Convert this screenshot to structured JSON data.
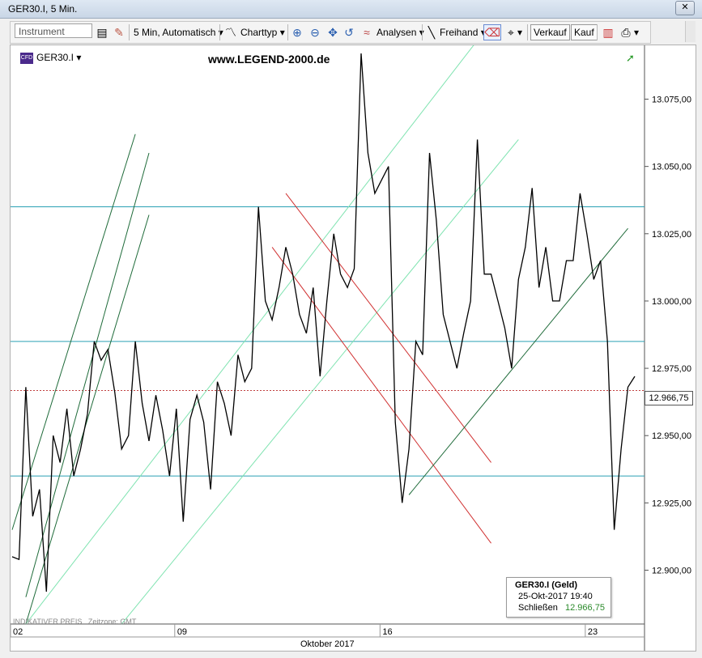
{
  "window": {
    "title": "GER30.I, 5 Min."
  },
  "toolbar": {
    "instrument_placeholder": "Instrument",
    "interval_label": "5 Min,  Automatisch",
    "charttype_label": "Charttyp",
    "analysen_label": "Analysen",
    "freehand_label": "Freihand",
    "sell_label": "Verkauf",
    "buy_label": "Kauf"
  },
  "chart": {
    "instrument": "GER30.I",
    "watermark": "www.LEGEND-2000.de",
    "indicative_label": "INDIKATIVER PREIS",
    "timezone_label": "Zeitzone: GMT",
    "current_price_tag": "12.966,75",
    "month_label": "Oktober 2017",
    "tooltip": {
      "header": "GER30.I (Geld)",
      "datetime": "25-Okt-2017 19:40",
      "label": "Schließen",
      "value": "12.966,75"
    }
  },
  "chart_data": {
    "type": "line",
    "ylim": [
      12880,
      13095
    ],
    "x_ticks": [
      "02",
      "09",
      "16",
      "23"
    ],
    "y_ticks": [
      "13.075,00",
      "13.050,00",
      "13.025,00",
      "13.000,00",
      "12.975,00",
      "12.950,00",
      "12.925,00",
      "12.900,00"
    ],
    "x_index": [
      0,
      1,
      2,
      3,
      4,
      5,
      6,
      7,
      8,
      9,
      10,
      11,
      12,
      13,
      14,
      15,
      16,
      17,
      18,
      19,
      20,
      21,
      22,
      23,
      24,
      25,
      26,
      27,
      28,
      29,
      30,
      31,
      32,
      33,
      34,
      35,
      36,
      37,
      38,
      39,
      40,
      41,
      42,
      43,
      44,
      45,
      46,
      47,
      48,
      49,
      50,
      51,
      52,
      53,
      54,
      55,
      56,
      57,
      58,
      59,
      60,
      61,
      62,
      63,
      64,
      65,
      66,
      67,
      68,
      69,
      70,
      71,
      72,
      73,
      74,
      75,
      76,
      77,
      78,
      79,
      80,
      81,
      82,
      83,
      84,
      85,
      86,
      87,
      88,
      89,
      90,
      91
    ],
    "values": [
      12905,
      12904,
      12968,
      12920,
      12930,
      12892,
      12950,
      12940,
      12960,
      12935,
      12945,
      12958,
      12985,
      12978,
      12982,
      12966,
      12945,
      12950,
      12985,
      12962,
      12948,
      12965,
      12952,
      12935,
      12960,
      12918,
      12956,
      12965,
      12955,
      12930,
      12970,
      12962,
      12950,
      12980,
      12970,
      12975,
      13035,
      13000,
      12993,
      13005,
      13020,
      13010,
      12995,
      12988,
      13005,
      12972,
      13000,
      13025,
      13010,
      13005,
      13012,
      13092,
      13055,
      13040,
      13045,
      13050,
      12955,
      12925,
      12945,
      12985,
      12980,
      13055,
      13030,
      12995,
      12985,
      12975,
      12988,
      13000,
      13060,
      13010,
      13010,
      13000,
      12990,
      12975,
      13008,
      13020,
      13042,
      13005,
      13020,
      13000,
      13000,
      13015,
      13015,
      13040,
      13025,
      13008,
      13015,
      12985,
      12915,
      12945,
      12968,
      12972
    ],
    "horizontal_lines": [
      13035,
      12985,
      12935
    ],
    "current_price_line": 12966.75,
    "series_colors": {
      "price": "#000000",
      "hline": "#2aa0b4",
      "channel_light": "#7fe3b0",
      "channel_dark": "#1f6b3a",
      "channel_red": "#d03030",
      "current": "#c04040"
    }
  },
  "icons": [
    "instrument-lookup-icon",
    "drawing-tools-icon",
    "line-chart-icon",
    "zoom-in-icon",
    "zoom-out-icon",
    "pan-icon",
    "undo-icon",
    "analysis-icon",
    "freehand-line-icon",
    "eraser-icon",
    "crosshair-icon",
    "chart-window-icon",
    "print-icon"
  ]
}
